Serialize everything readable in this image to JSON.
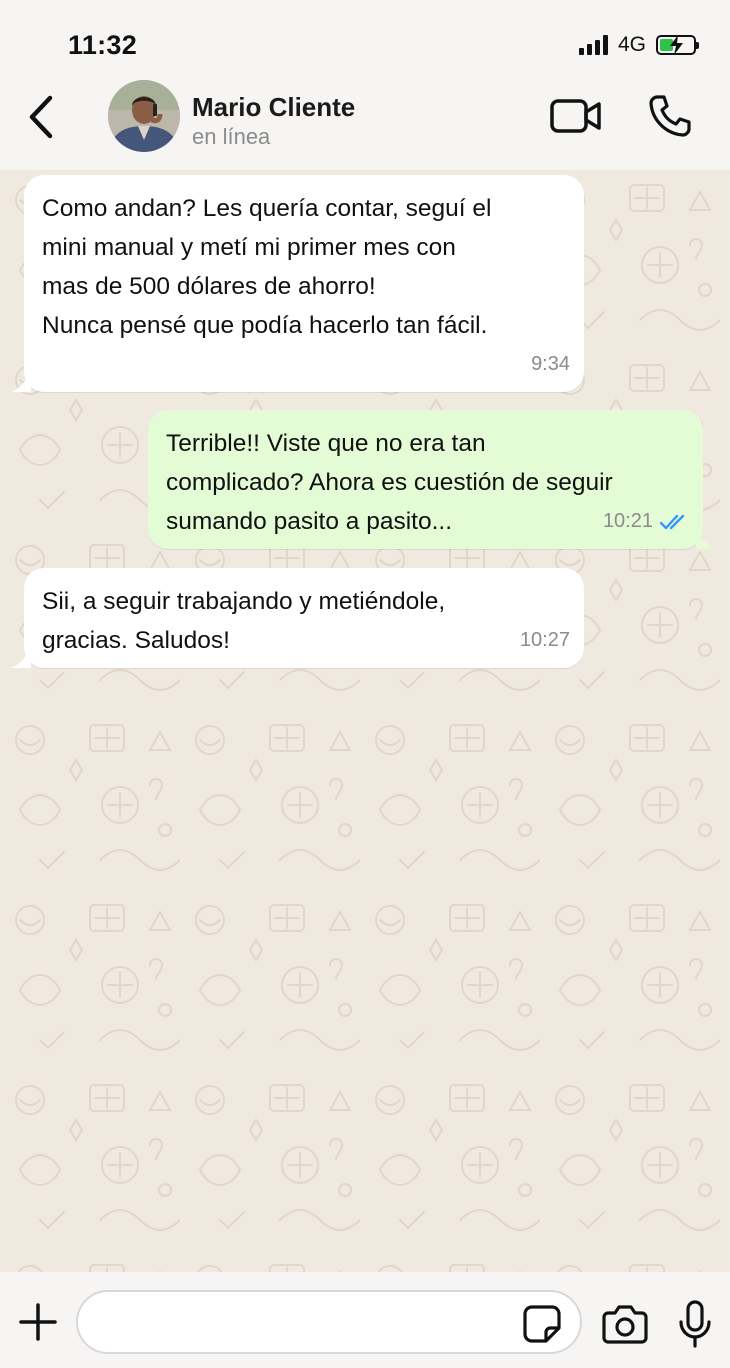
{
  "status_bar": {
    "time": "11:32",
    "network": "4G",
    "battery_level": 0.4,
    "signal_bars": 4
  },
  "header": {
    "contact_name": "Mario Cliente",
    "contact_status": "en línea",
    "icons": [
      "back-icon",
      "avatar",
      "video-call-icon",
      "phone-icon"
    ]
  },
  "messages": [
    {
      "direction": "incoming",
      "text": "Como andan? Les quería contar, seguí el\nmini manual y metí mi primer mes con\nmas de 500 dólares de ahorro!\nNunca pensé que podía hacerlo tan fácil.",
      "time": "9:34"
    },
    {
      "direction": "outgoing",
      "text": "Terrible!! Viste que no era tan\ncomplicado? Ahora es cuestión de seguir\nsumando pasito a pasito...",
      "time": "10:21",
      "read_status": "read"
    },
    {
      "direction": "incoming",
      "text": "Sii, a seguir trabajando y metiéndole,\ngracias. Saludos!",
      "time": "10:27"
    }
  ],
  "composer": {
    "input_value": "",
    "icons": [
      "plus-icon",
      "sticker-icon",
      "camera-icon",
      "microphone-icon"
    ]
  },
  "colors": {
    "incoming_bubble": "#ffffff",
    "outgoing_bubble": "#e3fcd6",
    "read_ticks": "#3497f9",
    "chat_background": "#efe9df",
    "bar_background": "#f6f5f3"
  }
}
